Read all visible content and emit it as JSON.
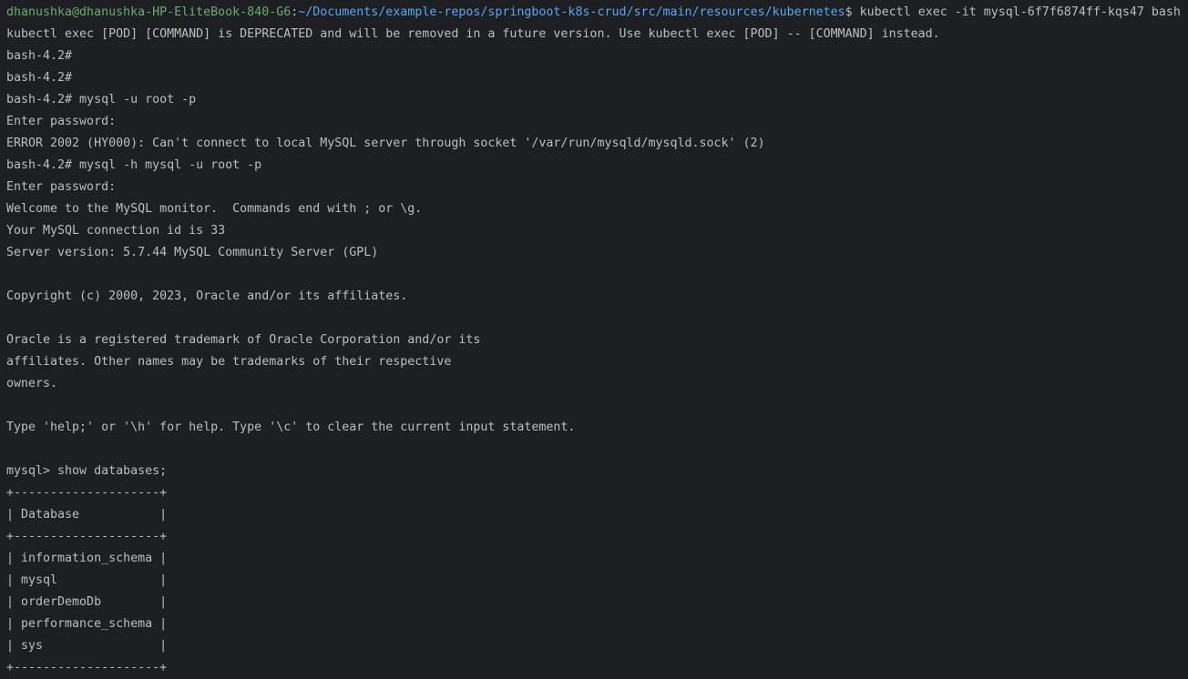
{
  "colors": {
    "background": "#1e1f22",
    "foreground": "#bcbec4",
    "prompt_user": "#6aab73",
    "prompt_path": "#56a8f5"
  },
  "prompt": {
    "user_host": "dhanushka@dhanushka-HP-EliteBook-840-G6",
    "separator": ":",
    "path": "~/Documents/example-repos/springboot-k8s-crud/src/main/resources/kubernetes",
    "symbol": "$ ",
    "command": "kubectl exec -it mysql-6f7f6874ff-kqs47 bash"
  },
  "lines": [
    "kubectl exec [POD] [COMMAND] is DEPRECATED and will be removed in a future version. Use kubectl exec [POD] -- [COMMAND] instead.",
    "bash-4.2#",
    "bash-4.2#",
    "bash-4.2# mysql -u root -p",
    "Enter password:",
    "ERROR 2002 (HY000): Can't connect to local MySQL server through socket '/var/run/mysqld/mysqld.sock' (2)",
    "bash-4.2# mysql -h mysql -u root -p",
    "Enter password:",
    "Welcome to the MySQL monitor.  Commands end with ; or \\g.",
    "Your MySQL connection id is 33",
    "Server version: 5.7.44 MySQL Community Server (GPL)",
    "",
    "Copyright (c) 2000, 2023, Oracle and/or its affiliates.",
    "",
    "Oracle is a registered trademark of Oracle Corporation and/or its",
    "affiliates. Other names may be trademarks of their respective",
    "owners.",
    "",
    "Type 'help;' or '\\h' for help. Type '\\c' to clear the current input statement.",
    "",
    "mysql> show databases;",
    "+--------------------+",
    "| Database           |",
    "+--------------------+",
    "| information_schema |",
    "| mysql              |",
    "| orderDemoDb        |",
    "| performance_schema |",
    "| sys                |",
    "+--------------------+"
  ]
}
